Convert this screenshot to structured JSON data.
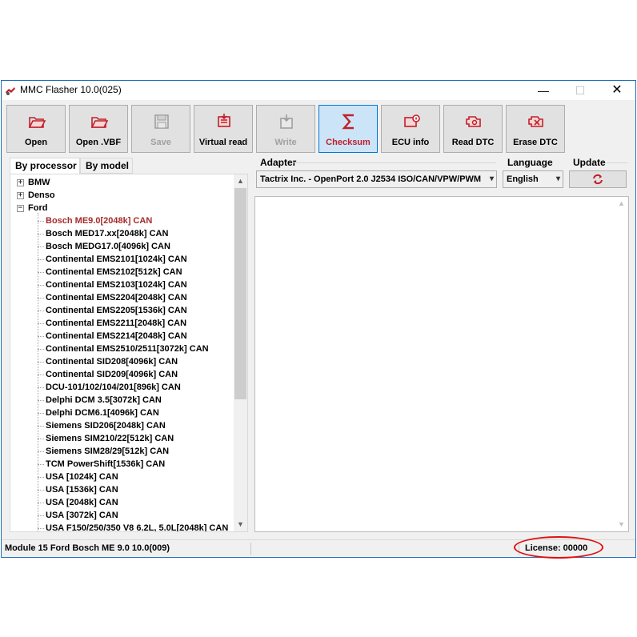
{
  "window": {
    "title": "MMC Flasher 10.0(025)",
    "controls": {
      "minimize": "—",
      "maximize": "☐",
      "close": "✕"
    }
  },
  "toolbar": [
    {
      "label": "Open",
      "icon": "folder-open-icon",
      "enabled": true
    },
    {
      "label": "Open .VBF",
      "icon": "folder-open-icon",
      "enabled": true
    },
    {
      "label": "Save",
      "icon": "save-disk-icon",
      "enabled": false
    },
    {
      "label": "Virtual read",
      "icon": "virtual-read-icon",
      "enabled": true
    },
    {
      "label": "Write",
      "icon": "write-icon",
      "enabled": false
    },
    {
      "label": "Checksum",
      "icon": "sigma-icon",
      "enabled": true,
      "active": true
    },
    {
      "label": "ECU info",
      "icon": "ecu-info-icon",
      "enabled": true
    },
    {
      "label": "Read DTC",
      "icon": "engine-read-icon",
      "enabled": true
    },
    {
      "label": "Erase DTC",
      "icon": "engine-erase-icon",
      "enabled": true
    }
  ],
  "tabs": {
    "by_processor": "By processor",
    "by_model": "By model"
  },
  "tree": {
    "groups": [
      {
        "label": "BMW",
        "expanded": false,
        "sign": "+"
      },
      {
        "label": "Denso",
        "expanded": false,
        "sign": "+"
      },
      {
        "label": "Ford",
        "expanded": true,
        "sign": "−"
      }
    ],
    "ford_items": [
      "Bosch ME9.0[2048k] CAN",
      "Bosch MED17.xx[2048k] CAN",
      "Bosch MEDG17.0[4096k] CAN",
      "Continental EMS2101[1024k] CAN",
      "Continental EMS2102[512k] CAN",
      "Continental EMS2103[1024k] CAN",
      "Continental EMS2204[2048k] CAN",
      "Continental EMS2205[1536k] CAN",
      "Continental EMS2211[2048k] CAN",
      "Continental EMS2214[2048k] CAN",
      "Continental EMS2510/2511[3072k] CAN",
      "Continental SID208[4096k] CAN",
      "Continental SID209[4096k] CAN",
      "DCU-101/102/104/201[896k] CAN",
      "Delphi DCM 3.5[3072k] CAN",
      "Delphi DCM6.1[4096k] CAN",
      "Siemens SID206[2048k] CAN",
      "Siemens SIM210/22[512k] CAN",
      "Siemens SIM28/29[512k] CAN",
      "TCM PowerShift[1536k] CAN",
      "USA [1024k] CAN",
      "USA [1536k] CAN",
      "USA [2048k] CAN",
      "USA [3072k] CAN",
      "USA F150/250/350 V8 6.2L, 5.0L[2048k] CAN"
    ],
    "selected_index": 0,
    "scroll_up": "▲",
    "scroll_down": "▼"
  },
  "adapter": {
    "label": "Adapter",
    "value": "Tactrix Inc. - OpenPort 2.0 J2534 ISO/CAN/VPW/PWM"
  },
  "language": {
    "label": "Language",
    "value": "English"
  },
  "update": {
    "label": "Update",
    "icon": "refresh-icon"
  },
  "status": {
    "module": "Module 15 Ford Bosch ME 9.0 10.0(009)",
    "license": "License: 00000"
  },
  "colors": {
    "accent": "#c0202a",
    "highlight": "#a52a2a",
    "annotation": "#e01010"
  }
}
